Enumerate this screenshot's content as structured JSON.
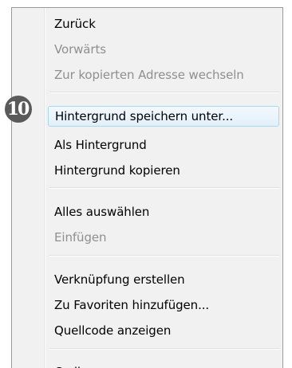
{
  "step_badge": "10",
  "context_menu": {
    "items": [
      {
        "label": "Zurück",
        "enabled": true
      },
      {
        "label": "Vorwärts",
        "enabled": false
      },
      {
        "label": "Zur kopierten Adresse wechseln",
        "enabled": false
      },
      {
        "label": "Hintergrund speichern unter...",
        "enabled": true,
        "highlighted": true
      },
      {
        "label": "Als Hintergrund",
        "enabled": true
      },
      {
        "label": "Hintergrund kopieren",
        "enabled": true
      },
      {
        "label": "Alles auswählen",
        "enabled": true
      },
      {
        "label": "Einfügen",
        "enabled": false
      },
      {
        "label": "Verknüpfung erstellen",
        "enabled": true
      },
      {
        "label": "Zu Favoriten hinzufügen...",
        "enabled": true
      },
      {
        "label": "Quellcode anzeigen",
        "enabled": true
      },
      {
        "label": "Codierung",
        "enabled": true
      }
    ]
  }
}
